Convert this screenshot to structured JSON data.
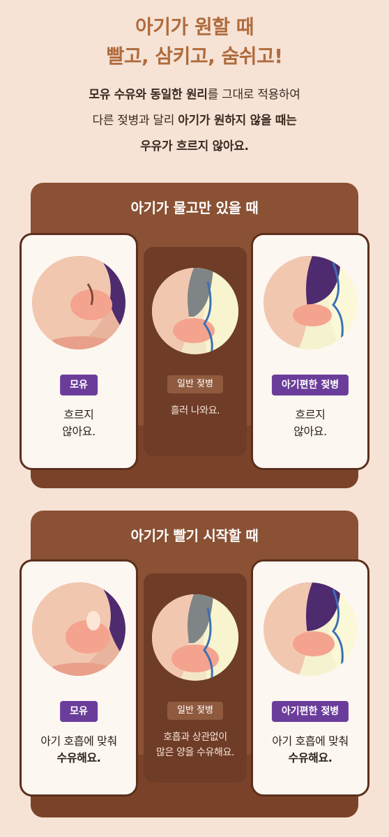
{
  "header": {
    "line1": "아기가 원할 때",
    "line2": "빨고, 삼키고, 숨쉬고!",
    "sub_line1_bold": "모유 수유와 동일한 원리",
    "sub_line1_rest": "를 그대로 적용하여",
    "sub_line2_plain": "다른 젖병과 달리 ",
    "sub_line2_bold": "아기가 원하지 않을 때는",
    "sub_line3_bold": "우유가 흐르지 않아요."
  },
  "sections": [
    {
      "title": "아기가 물고만 있을 때",
      "left": {
        "badge": "모유",
        "text_line1": "흐르지",
        "text_line2": "않아요."
      },
      "middle": {
        "badge": "일반 젖병",
        "text_line1": "흘러 나와요.",
        "text_line2": ""
      },
      "right": {
        "badge": "아기편한 젖병",
        "text_line1": "흐르지",
        "text_line2": "않아요."
      }
    },
    {
      "title": "아기가 빨기 시작할 때",
      "left": {
        "badge": "모유",
        "text_line1": "아기 호흡에 맞춰",
        "text_line2": "수유해요."
      },
      "middle": {
        "badge": "일반 젖병",
        "text_line1": "호흡과 상관없이",
        "text_line2": "많은 양을 수유해요."
      },
      "right": {
        "badge": "아기편한 젖병",
        "text_line1": "아기 호흡에 맞춰",
        "text_line2": "수유해요."
      }
    }
  ],
  "colors": {
    "background": "#f6e3d6",
    "headline": "#b06b3c",
    "section": "#8a5134",
    "badge_purple": "#6b3d9a",
    "badge_brown": "#8f5a3e"
  }
}
